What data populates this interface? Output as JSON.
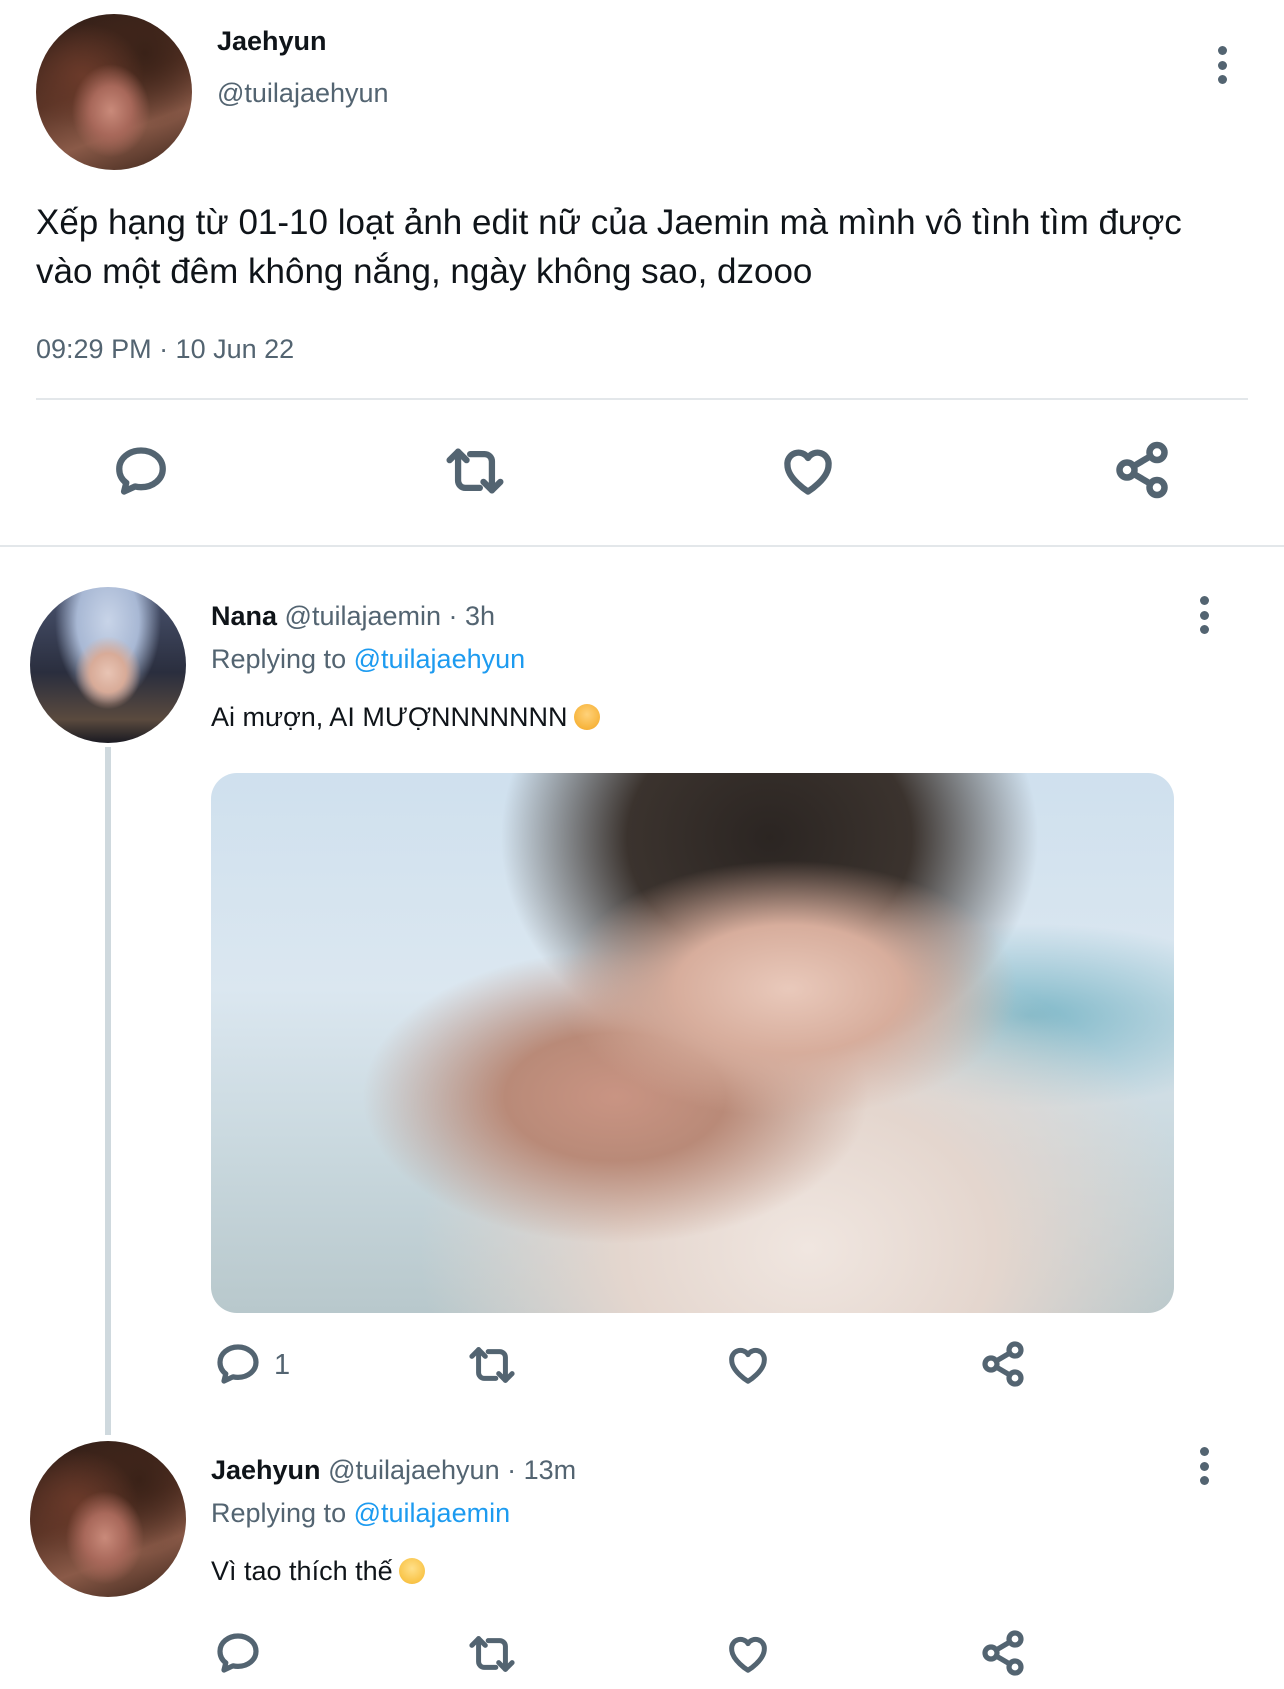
{
  "main_tweet": {
    "name": "Jaehyun",
    "handle": "@tuilajaehyun",
    "text": "Xếp hạng từ 01-10 loạt ảnh edit nữ của Jaemin mà mình vô tình tìm được vào một đêm không nắng, ngày không sao, dzooo",
    "timestamp": "09:29 PM · 10 Jun 22",
    "icons": [
      "reply-icon",
      "retweet-icon",
      "like-icon",
      "share-icon"
    ]
  },
  "reply1": {
    "name": "Nana",
    "handle": "@tuilajaemin",
    "time": "· 3h",
    "replying_label": "Replying to",
    "replying_to": "@tuilajaehyun",
    "text": "Ai mượn, AI MƯỢNNNNNNN",
    "emoji": "angry-face-emoji",
    "reply_count": "1"
  },
  "reply2": {
    "name": "Jaehyun",
    "handle": "@tuilajaehyun",
    "time": "· 13m",
    "replying_label": "Replying to",
    "replying_to": "@tuilajaemin",
    "text": "Vì tao thích thế",
    "emoji": "hugging-face-emoji"
  },
  "colors": {
    "link": "#1d9bf0",
    "muted": "#536471",
    "divider": "#cfd9de"
  }
}
